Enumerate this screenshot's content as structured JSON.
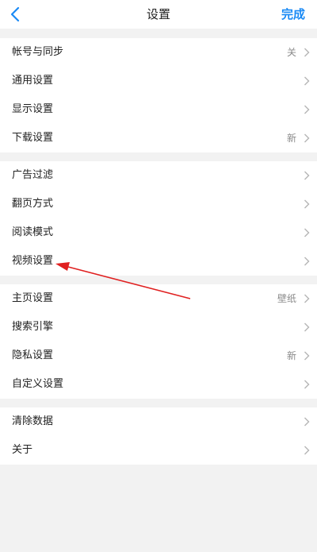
{
  "header": {
    "title": "设置",
    "done_label": "完成"
  },
  "groups": [
    {
      "items": [
        {
          "label": "帐号与同步",
          "value": "关"
        },
        {
          "label": "通用设置",
          "value": ""
        },
        {
          "label": "显示设置",
          "value": ""
        },
        {
          "label": "下载设置",
          "value": "新"
        }
      ]
    },
    {
      "items": [
        {
          "label": "广告过滤",
          "value": ""
        },
        {
          "label": "翻页方式",
          "value": ""
        },
        {
          "label": "阅读模式",
          "value": ""
        },
        {
          "label": "视频设置",
          "value": ""
        }
      ]
    },
    {
      "items": [
        {
          "label": "主页设置",
          "value": "壁纸"
        },
        {
          "label": "搜索引擎",
          "value": ""
        },
        {
          "label": "隐私设置",
          "value": "新"
        },
        {
          "label": "自定义设置",
          "value": ""
        }
      ]
    },
    {
      "items": [
        {
          "label": "清除数据",
          "value": ""
        },
        {
          "label": "关于",
          "value": ""
        }
      ]
    }
  ],
  "colors": {
    "accent": "#1a8af5",
    "background": "#f2f2f2",
    "annotation_arrow": "#e02020"
  },
  "icons": {
    "back": "back-chevron-icon",
    "row_chevron": "chevron-right-icon"
  }
}
